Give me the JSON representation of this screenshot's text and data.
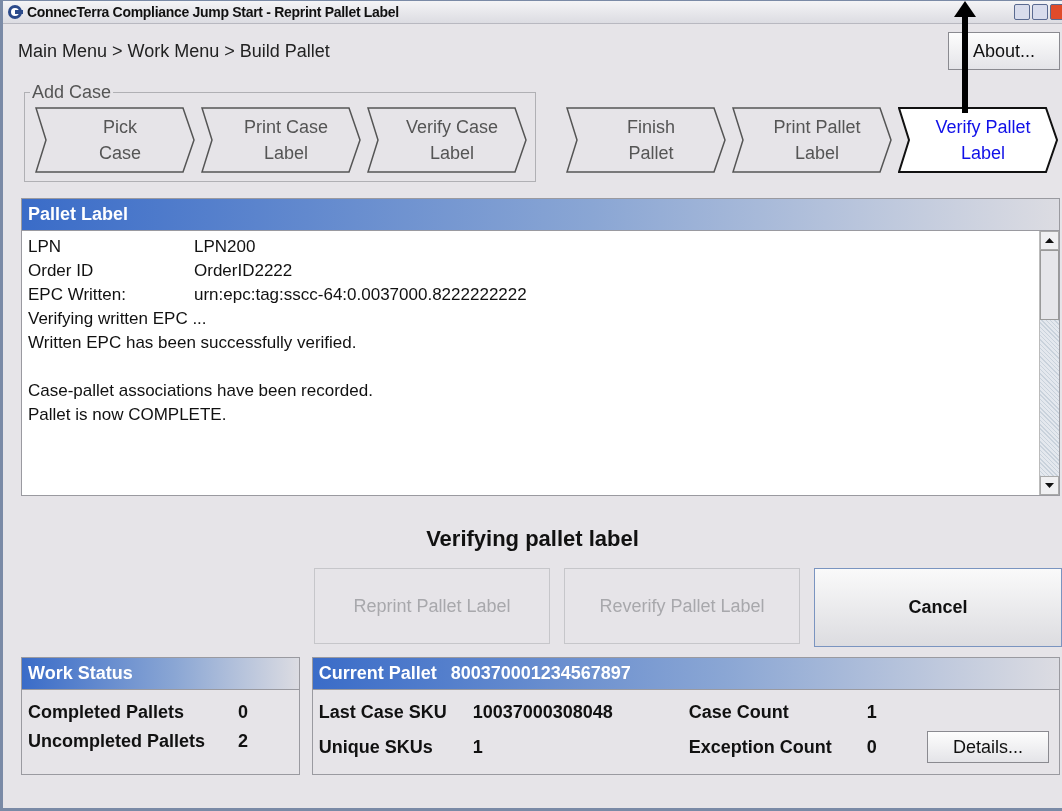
{
  "window": {
    "title": "ConnecTerra Compliance Jump Start - Reprint Pallet Label"
  },
  "breadcrumb": "Main Menu > Work Menu > Build Pallet",
  "about_button": "About...",
  "case_steps": {
    "label": "Add Case",
    "steps": [
      {
        "lines": [
          "Pick",
          "Case"
        ],
        "selected": false
      },
      {
        "lines": [
          "Print Case",
          "Label"
        ],
        "selected": false
      },
      {
        "lines": [
          "Verify Case",
          "Label"
        ],
        "selected": false
      }
    ]
  },
  "pallet_steps": [
    {
      "lines": [
        "Finish",
        "Pallet"
      ],
      "selected": false
    },
    {
      "lines": [
        "Print Pallet",
        "Label"
      ],
      "selected": false
    },
    {
      "lines": [
        "Verify Pallet",
        "Label"
      ],
      "selected": true
    }
  ],
  "log_panel": {
    "title": "Pallet Label",
    "lines": [
      {
        "kind": "field",
        "label": "LPN",
        "value": "LPN200"
      },
      {
        "kind": "field",
        "label": "Order ID",
        "value": "OrderID2222"
      },
      {
        "kind": "field",
        "label": "EPC Written:",
        "value": "urn:epc:tag:sscc-64:0.0037000.8222222222"
      },
      {
        "kind": "text",
        "text": "Verifying written EPC ..."
      },
      {
        "kind": "text",
        "text": "Written EPC has been successfully verified."
      },
      {
        "kind": "gap"
      },
      {
        "kind": "text",
        "text": "Case-pallet associations have been recorded."
      },
      {
        "kind": "text",
        "text": "Pallet is now COMPLETE."
      }
    ]
  },
  "status_message": "Verifying pallet label",
  "action_buttons": [
    {
      "label": "Reprint Pallet Label",
      "disabled": true
    },
    {
      "label": "Reverify Pallet Label",
      "disabled": true
    },
    {
      "label": "Cancel",
      "disabled": false
    }
  ],
  "work_status": {
    "title": "Work Status",
    "rows": [
      {
        "label": "Completed Pallets",
        "value": "0"
      },
      {
        "label": "Uncompleted Pallets",
        "value": "2"
      }
    ]
  },
  "current_pallet": {
    "title": "Current Pallet",
    "value": "800370001234567897",
    "fields": [
      {
        "label": "Last Case SKU",
        "value": "10037000308048"
      },
      {
        "label": "Case Count",
        "value": "1"
      },
      {
        "label": "Unique SKUs",
        "value": "1"
      },
      {
        "label": "Exception Count",
        "value": "0"
      }
    ],
    "details_button": "Details..."
  }
}
